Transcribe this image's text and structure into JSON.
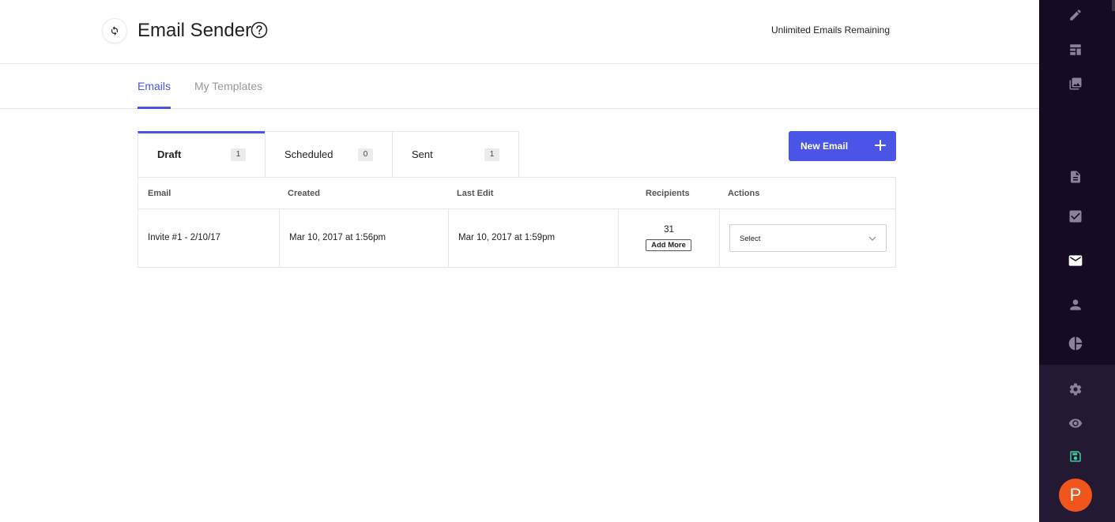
{
  "header": {
    "title": "Email Sender",
    "remaining": "Unlimited Emails Remaining"
  },
  "tabs": [
    {
      "label": "Emails",
      "active": true
    },
    {
      "label": "My Templates",
      "active": false
    }
  ],
  "status_tabs": [
    {
      "label": "Draft",
      "count": "1",
      "active": true
    },
    {
      "label": "Scheduled",
      "count": "0",
      "active": false
    },
    {
      "label": "Sent",
      "count": "1",
      "active": false
    }
  ],
  "new_email_button": {
    "label": "New Email"
  },
  "table": {
    "columns": [
      "Email",
      "Created",
      "Last Edit",
      "Recipients",
      "Actions"
    ],
    "rows": [
      {
        "email": "Invite #1 - 2/10/17",
        "created": "Mar 10, 2017 at 1:56pm",
        "last_edit": "Mar 10, 2017 at 1:59pm",
        "recipients": "31",
        "add_more_label": "Add More",
        "action_select": "Select"
      }
    ]
  },
  "sidebar": {
    "icons": [
      "pencil-icon",
      "layout-icon",
      "image-icon",
      "document-icon",
      "checkbox-icon",
      "mail-icon",
      "person-icon",
      "pie-chart-icon",
      "gear-icon",
      "eye-icon",
      "save-icon"
    ],
    "active": "mail-icon",
    "avatar_letter": "P",
    "colors": {
      "background": "#150b22",
      "lower_background": "#231933",
      "icon": "#8a8396",
      "active_icon": "#ffffff",
      "save_icon": "#3ccf9e",
      "avatar": "#f1551b"
    }
  },
  "colors": {
    "accent": "#4a55e8"
  }
}
